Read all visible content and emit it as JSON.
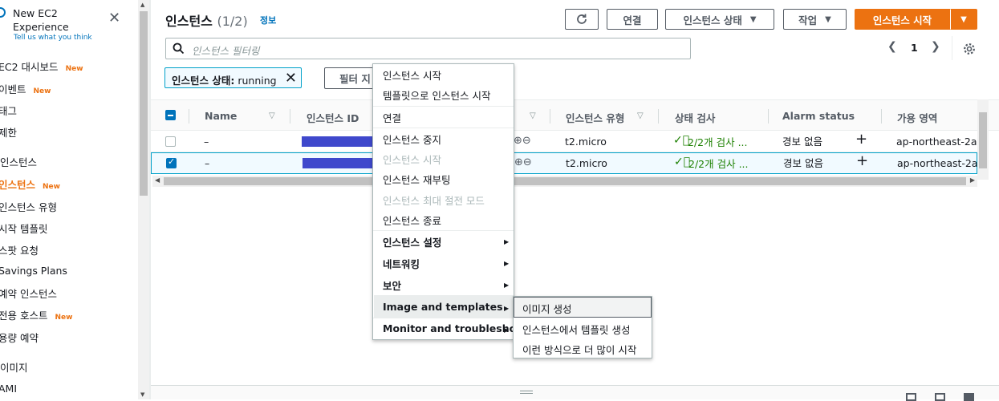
{
  "sidebar": {
    "title_line1": "New EC2",
    "title_line2": "Experience",
    "subtitle": "Tell us what you think",
    "new_badge": "New",
    "items": [
      {
        "label": "EC2 대시보드",
        "new": true
      },
      {
        "label": "이벤트",
        "new": true
      },
      {
        "label": "태그",
        "new": false
      },
      {
        "label": "제한",
        "new": false
      }
    ],
    "section_instances": "인스턴스",
    "instance_items": [
      {
        "label": "인스턴스",
        "new": true,
        "active": true
      },
      {
        "label": "인스턴스 유형",
        "new": false
      },
      {
        "label": "시작 템플릿",
        "new": false
      },
      {
        "label": "스팟 요청",
        "new": false
      },
      {
        "label": "Savings Plans",
        "new": false
      },
      {
        "label": "예약 인스턴스",
        "new": false
      },
      {
        "label": "전용 호스트",
        "new": true
      },
      {
        "label": "용량 예약",
        "new": false
      }
    ],
    "section_images": "이미지",
    "image_items": [
      {
        "label": "AMI"
      }
    ]
  },
  "header": {
    "title": "인스턴스",
    "count": "(1/2)",
    "info": "정보",
    "refresh_icon": "refresh-icon",
    "connect": "연결",
    "instance_state": "인스턴스 상태",
    "actions": "작업",
    "launch": "인스턴스 시작"
  },
  "search": {
    "placeholder": "인스턴스 필터링"
  },
  "pagination": {
    "page": "1"
  },
  "filter_token": {
    "key": "인스턴스 상태:",
    "value": "running"
  },
  "clear_filter": "필터 지",
  "table": {
    "columns": [
      "Name",
      "인스턴스 ID",
      "인스턴스 유형",
      "상태 검사",
      "Alarm status",
      "가용 영역"
    ],
    "rows": [
      {
        "name": "–",
        "type": "t2.micro",
        "status": "2/2개 검사 ...",
        "alarm": "경보 없음",
        "az": "ap-northeast-2a",
        "selected": false
      },
      {
        "name": "–",
        "type": "t2.micro",
        "status": "2/2개 검사 ...",
        "alarm": "경보 없음",
        "az": "ap-northeast-2a",
        "selected": true
      }
    ]
  },
  "context_menu": {
    "items": [
      {
        "label": "인스턴스 시작"
      },
      {
        "label": "템플릿으로 인스턴스 시작"
      },
      {
        "label": "연결"
      },
      {
        "label": "인스턴스 중지"
      },
      {
        "label": "인스턴스 시작",
        "disabled": true
      },
      {
        "label": "인스턴스 재부팅"
      },
      {
        "label": "인스턴스 최대 절전 모드",
        "disabled": true
      },
      {
        "label": "인스턴스 종료"
      },
      {
        "label": "인스턴스 설정",
        "submenu": true
      },
      {
        "label": "네트워킹",
        "submenu": true
      },
      {
        "label": "보안",
        "submenu": true
      },
      {
        "label": "Image and templates",
        "submenu": true,
        "highlighted": true
      },
      {
        "label": "Monitor and troubleshoot",
        "submenu": true
      }
    ],
    "submenu": [
      {
        "label": "이미지 생성",
        "highlighted": true
      },
      {
        "label": "인스턴스에서 템플릿 생성"
      },
      {
        "label": "이런 방식으로 더 많이 시작"
      }
    ]
  },
  "colors": {
    "accent": "#ec7211",
    "link": "#0073bb",
    "ok": "#1d8102",
    "redaction": "#3f48cc"
  }
}
